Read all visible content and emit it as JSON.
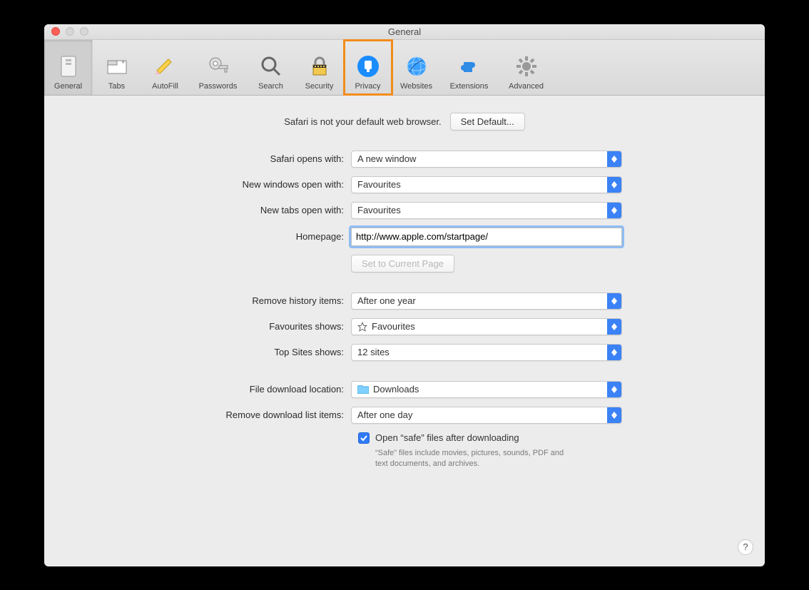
{
  "window": {
    "title": "General"
  },
  "toolbar": {
    "items": [
      {
        "id": "general",
        "label": "General"
      },
      {
        "id": "tabs",
        "label": "Tabs"
      },
      {
        "id": "autofill",
        "label": "AutoFill"
      },
      {
        "id": "passwords",
        "label": "Passwords"
      },
      {
        "id": "search",
        "label": "Search"
      },
      {
        "id": "security",
        "label": "Security"
      },
      {
        "id": "privacy",
        "label": "Privacy"
      },
      {
        "id": "websites",
        "label": "Websites"
      },
      {
        "id": "extensions",
        "label": "Extensions"
      },
      {
        "id": "advanced",
        "label": "Advanced"
      }
    ]
  },
  "default_browser": {
    "text": "Safari is not your default web browser.",
    "button": "Set Default..."
  },
  "settings": {
    "opens_with": {
      "label": "Safari opens with:",
      "value": "A new window"
    },
    "new_windows": {
      "label": "New windows open with:",
      "value": "Favourites"
    },
    "new_tabs": {
      "label": "New tabs open with:",
      "value": "Favourites"
    },
    "homepage": {
      "label": "Homepage:",
      "value": "http://www.apple.com/startpage/",
      "set_current": "Set to Current Page"
    },
    "remove_history": {
      "label": "Remove history items:",
      "value": "After one year"
    },
    "fav_shows": {
      "label": "Favourites shows:",
      "value": "Favourites"
    },
    "topsites": {
      "label": "Top Sites shows:",
      "value": "12 sites"
    },
    "download_loc": {
      "label": "File download location:",
      "value": "Downloads"
    },
    "remove_downloads": {
      "label": "Remove download list items:",
      "value": "After one day"
    },
    "open_safe": {
      "label": "Open “safe” files after downloading"
    },
    "safe_note": "“Safe” files include movies, pictures, sounds, PDF and text documents, and archives."
  },
  "help_tooltip": "?"
}
